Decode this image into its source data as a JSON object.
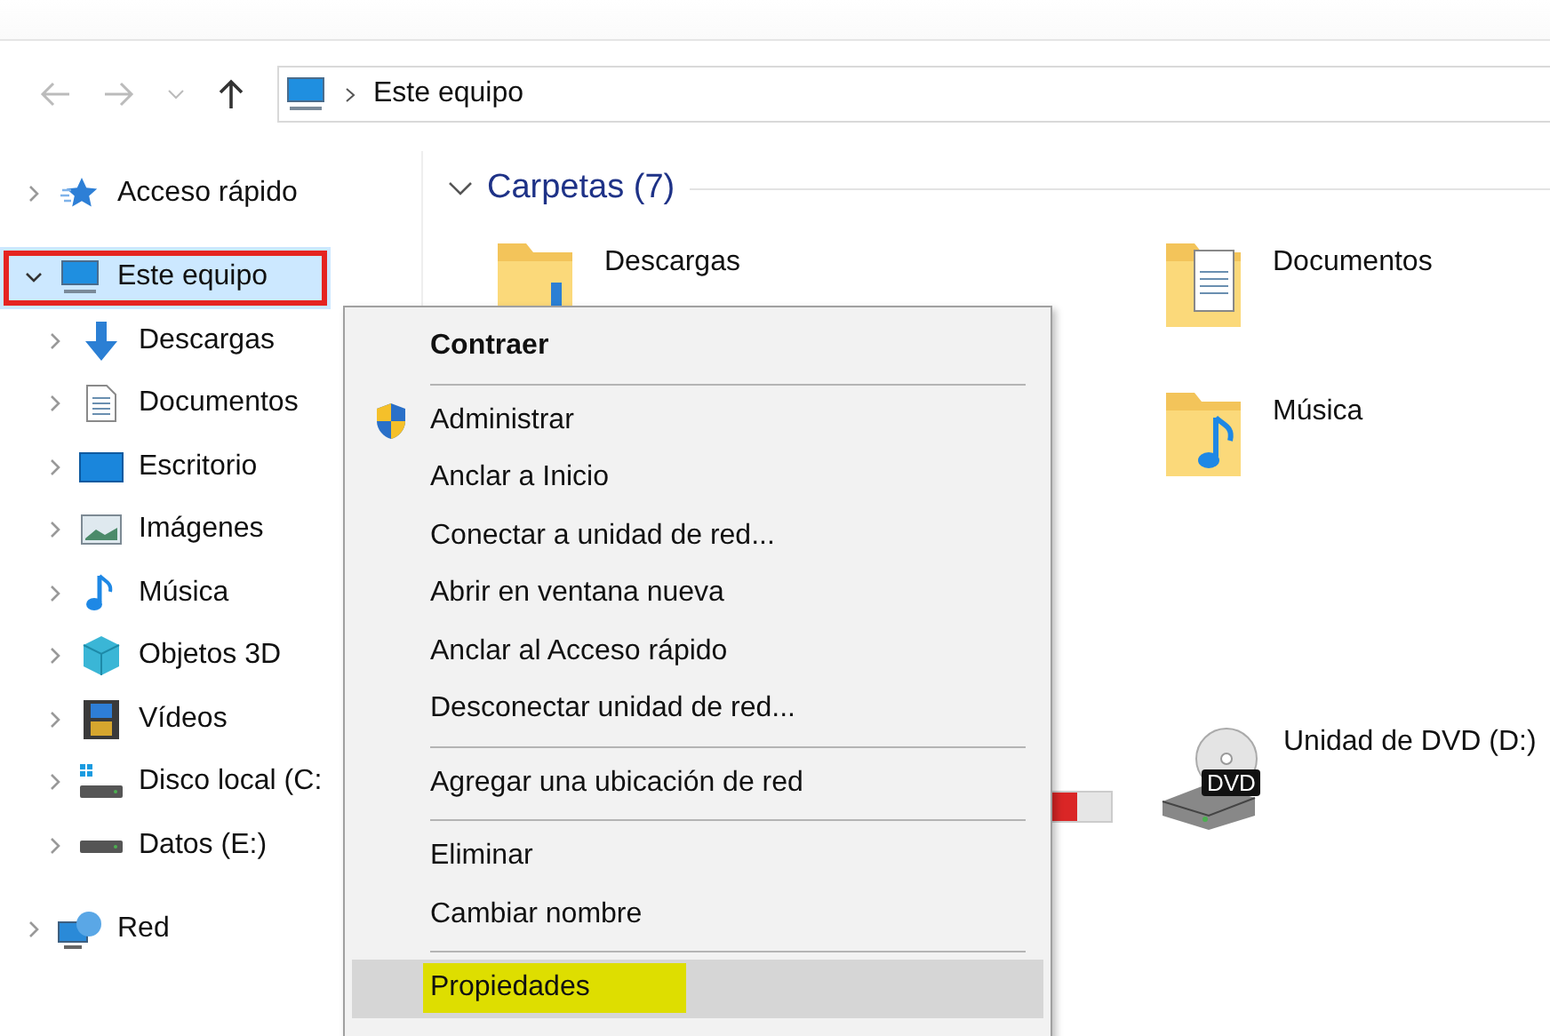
{
  "address_bar": {
    "path": [
      "Este equipo"
    ]
  },
  "sidebar": {
    "items": [
      {
        "label": "Acceso rápido",
        "kind": "star",
        "expanded": false,
        "selected": false,
        "annotated": false
      },
      {
        "label": "Este equipo",
        "kind": "pc",
        "expanded": true,
        "selected": true,
        "annotated": true,
        "children": [
          {
            "label": "Descargas",
            "kind": "download",
            "expanded": false,
            "selected": false,
            "annotated": false
          },
          {
            "label": "Documentos",
            "kind": "document",
            "expanded": false,
            "selected": false,
            "annotated": false
          },
          {
            "label": "Escritorio",
            "kind": "desktop",
            "expanded": false,
            "selected": false,
            "annotated": false
          },
          {
            "label": "Imágenes",
            "kind": "picture",
            "expanded": false,
            "selected": false,
            "annotated": false
          },
          {
            "label": "Música",
            "kind": "music",
            "expanded": false,
            "selected": false,
            "annotated": false
          },
          {
            "label": "Objetos 3D",
            "kind": "cube",
            "expanded": false,
            "selected": false,
            "annotated": false
          },
          {
            "label": "Vídeos",
            "kind": "film",
            "expanded": false,
            "selected": false,
            "annotated": false
          },
          {
            "label": "Disco local (C:",
            "kind": "windrive",
            "expanded": false,
            "selected": false,
            "annotated": false
          },
          {
            "label": "Datos (E:)",
            "kind": "drive",
            "expanded": false,
            "selected": false,
            "annotated": false
          }
        ]
      },
      {
        "label": "Red",
        "kind": "network",
        "expanded": false,
        "selected": false,
        "annotated": false
      }
    ]
  },
  "content": {
    "section": {
      "title": "Carpetas (7)",
      "expanded": true
    },
    "folders": [
      {
        "label": "Descargas",
        "kind": "download"
      },
      {
        "label": "Documentos",
        "kind": "document"
      },
      {
        "kind": "hidden"
      },
      {
        "label": "Música",
        "kind": "music"
      }
    ],
    "drive_bar": {
      "level": 0.9
    },
    "dvd": {
      "label": "Unidad de DVD (D:)",
      "badge": "DVD"
    }
  },
  "context_menu": {
    "items": [
      {
        "kind": "item",
        "label": "Contraer",
        "bold": true,
        "hovered": false,
        "highlighted": false
      },
      {
        "kind": "separator"
      },
      {
        "kind": "shield_item",
        "label": "Administrar",
        "bold": false,
        "hovered": false,
        "highlighted": false
      },
      {
        "kind": "item",
        "label": "Anclar a Inicio",
        "bold": false,
        "hovered": false,
        "highlighted": false
      },
      {
        "kind": "item",
        "label": "Conectar a unidad de red...",
        "bold": false,
        "hovered": false,
        "highlighted": false
      },
      {
        "kind": "item",
        "label": "Abrir en ventana nueva",
        "bold": false,
        "hovered": false,
        "highlighted": false
      },
      {
        "kind": "item",
        "label": "Anclar al Acceso rápido",
        "bold": false,
        "hovered": false,
        "highlighted": false
      },
      {
        "kind": "item",
        "label": "Desconectar unidad de red...",
        "bold": false,
        "hovered": false,
        "highlighted": false
      },
      {
        "kind": "separator"
      },
      {
        "kind": "item",
        "label": "Agregar una ubicación de red",
        "bold": false,
        "hovered": false,
        "highlighted": false
      },
      {
        "kind": "separator"
      },
      {
        "kind": "item",
        "label": "Eliminar",
        "bold": false,
        "hovered": false,
        "highlighted": false
      },
      {
        "kind": "item",
        "label": "Cambiar nombre",
        "bold": false,
        "hovered": false,
        "highlighted": false
      },
      {
        "kind": "separator"
      },
      {
        "kind": "item",
        "label": "Propiedades",
        "bold": false,
        "hovered": true,
        "highlighted": true
      }
    ]
  }
}
